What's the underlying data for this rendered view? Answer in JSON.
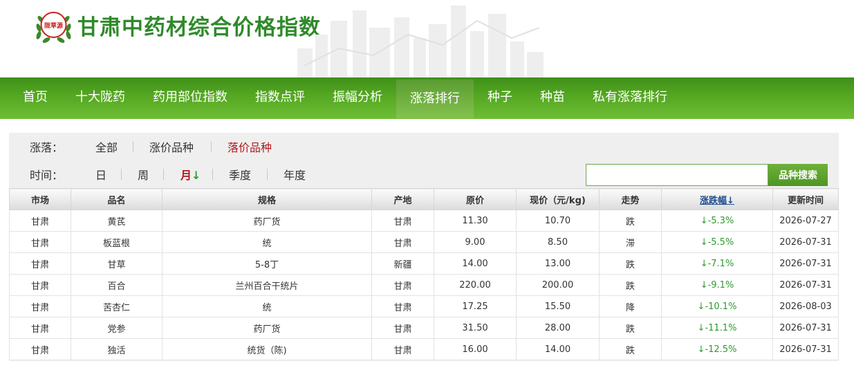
{
  "header": {
    "site_title": "甘肃中药材综合价格指数",
    "logo_text": "陇草源"
  },
  "nav": {
    "items": [
      "首页",
      "十大陇药",
      "药用部位指数",
      "指数点评",
      "振幅分析",
      "涨落排行",
      "种子",
      "种苗",
      "私有涨落排行"
    ],
    "active": "涨落排行"
  },
  "filters": {
    "change_label": "涨落：",
    "change_options": [
      "全部",
      "涨价品种",
      "落价品种"
    ],
    "change_selected": "落价品种",
    "time_label": "时间：",
    "time_options": [
      "日",
      "周",
      "月",
      "季度",
      "年度"
    ],
    "time_selected": "月",
    "time_sort_arrow": "↓"
  },
  "search": {
    "value": "",
    "placeholder": "",
    "button_label": "品种搜索"
  },
  "table": {
    "columns": [
      "市场",
      "品名",
      "规格",
      "产地",
      "原价",
      "现价（元/kg)",
      "走势",
      "涨跌幅↓",
      "更新时间"
    ],
    "rows": [
      [
        "甘肃",
        "黄芪",
        "药厂货",
        "甘肃",
        "11.30",
        "10.70",
        "跌",
        "↓-5.3%",
        "2026-07-27"
      ],
      [
        "甘肃",
        "板蓝根",
        "统",
        "甘肃",
        "9.00",
        "8.50",
        "滞",
        "↓-5.5%",
        "2026-07-31"
      ],
      [
        "甘肃",
        "甘草",
        "5-8丁",
        "新疆",
        "14.00",
        "13.00",
        "跌",
        "↓-7.1%",
        "2026-07-31"
      ],
      [
        "甘肃",
        "百合",
        "兰州百合干统片",
        "甘肃",
        "220.00",
        "200.00",
        "跌",
        "↓-9.1%",
        "2026-07-31"
      ],
      [
        "甘肃",
        "苦杏仁",
        "统",
        "甘肃",
        "17.25",
        "15.50",
        "降",
        "↓-10.1%",
        "2026-08-03"
      ],
      [
        "甘肃",
        "党参",
        "药厂货",
        "甘肃",
        "31.50",
        "28.00",
        "跌",
        "↓-11.1%",
        "2026-07-31"
      ],
      [
        "甘肃",
        "独活",
        "统货（陈)",
        "甘肃",
        "16.00",
        "14.00",
        "跌",
        "↓-12.5%",
        "2026-07-31"
      ]
    ]
  },
  "colors": {
    "brand_green": "#55a822",
    "title_green": "#2f8a2a",
    "selected_red": "#b0191e",
    "down_green": "#2e9a2e"
  }
}
